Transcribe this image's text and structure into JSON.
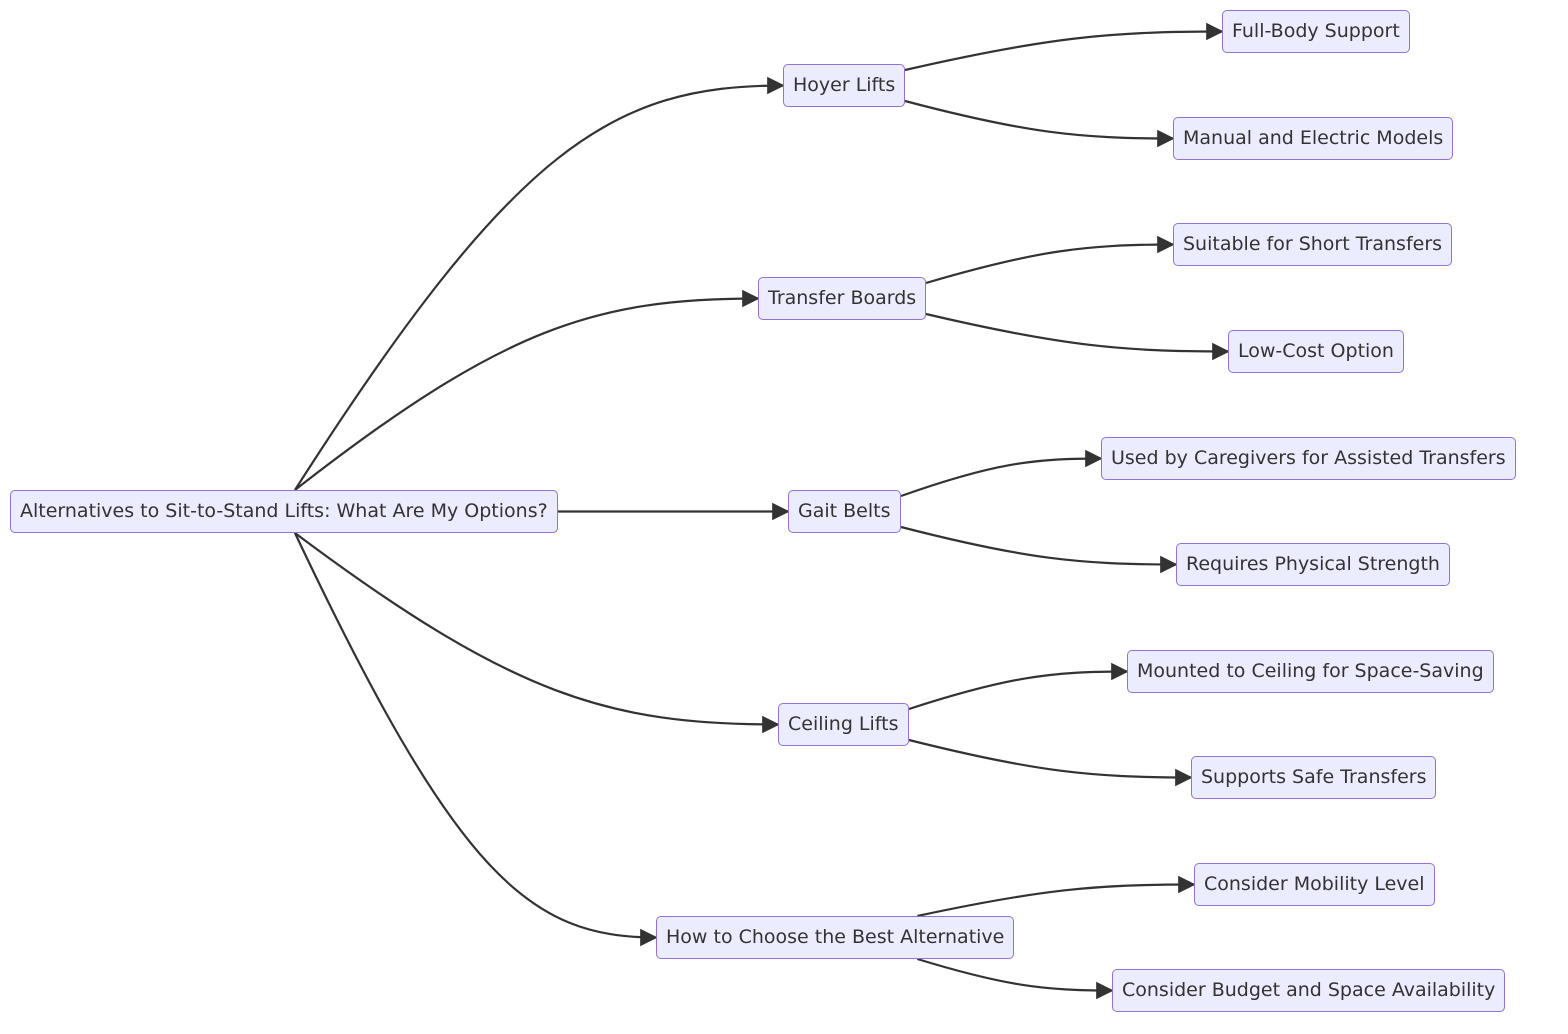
{
  "diagram": {
    "type": "flowchart",
    "direction": "LR",
    "colors": {
      "node_fill": "#ECECFF",
      "node_border": "#9370DB",
      "edge": "#333333",
      "text": "#333333"
    },
    "root": {
      "id": "root",
      "label": "Alternatives to Sit-to-Stand Lifts: What Are My Options?"
    },
    "branches": [
      {
        "id": "hoyer",
        "label": "Hoyer Lifts",
        "children": [
          {
            "id": "hoyer-1",
            "label": "Full-Body Support"
          },
          {
            "id": "hoyer-2",
            "label": "Manual and Electric Models"
          }
        ]
      },
      {
        "id": "transfer",
        "label": "Transfer Boards",
        "children": [
          {
            "id": "transfer-1",
            "label": "Suitable for Short Transfers"
          },
          {
            "id": "transfer-2",
            "label": "Low-Cost Option"
          }
        ]
      },
      {
        "id": "gait",
        "label": "Gait Belts",
        "children": [
          {
            "id": "gait-1",
            "label": "Used by Caregivers for Assisted Transfers"
          },
          {
            "id": "gait-2",
            "label": "Requires Physical Strength"
          }
        ]
      },
      {
        "id": "ceiling",
        "label": "Ceiling Lifts",
        "children": [
          {
            "id": "ceiling-1",
            "label": "Mounted to Ceiling for Space-Saving"
          },
          {
            "id": "ceiling-2",
            "label": "Supports Safe Transfers"
          }
        ]
      },
      {
        "id": "choose",
        "label": "How to Choose the Best Alternative",
        "children": [
          {
            "id": "choose-1",
            "label": "Consider Mobility Level"
          },
          {
            "id": "choose-2",
            "label": "Consider Budget and Space Availability"
          }
        ]
      }
    ]
  }
}
